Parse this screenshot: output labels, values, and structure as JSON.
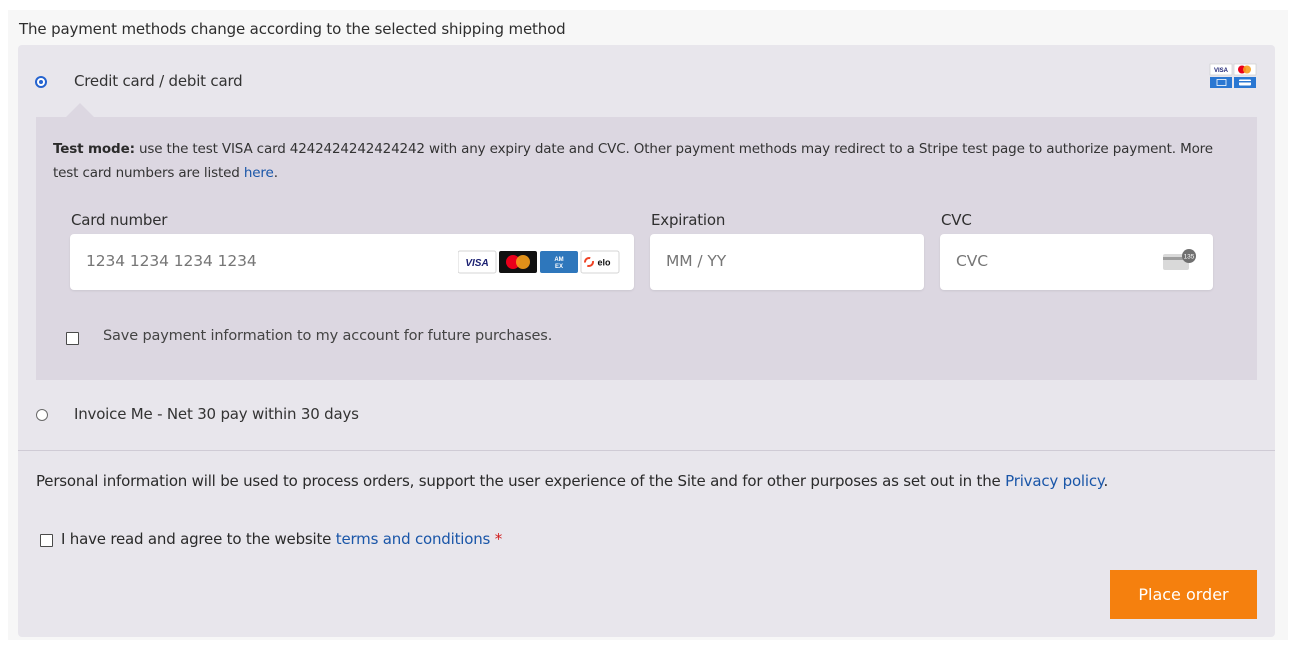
{
  "notice": "The payment methods change according to the selected shipping method",
  "payment_methods": [
    {
      "label": "Credit card / debit card",
      "selected": true
    },
    {
      "label": "Invoice Me - Net 30 pay within 30 days",
      "selected": false
    }
  ],
  "card_logos_icon": "credit-card-brands-icon",
  "test_mode": {
    "bold": "Test mode:",
    "text": " use the test VISA card 4242424242424242 with any expiry date and CVC. Other payment methods may redirect to a Stripe test page to authorize payment. More test card numbers are listed ",
    "link": "here",
    "end": "."
  },
  "fields": {
    "card_number": {
      "label": "Card number",
      "placeholder": "1234 1234 1234 1234",
      "brands": [
        "VISA",
        "mastercard",
        "AMEX",
        "elo"
      ]
    },
    "expiration": {
      "label": "Expiration",
      "placeholder": "MM / YY"
    },
    "cvc": {
      "label": "CVC",
      "placeholder": "CVC",
      "icon_text": "135"
    }
  },
  "save_payment": {
    "label": "Save payment information to my account for future purchases.",
    "checked": false
  },
  "privacy": {
    "text": "Personal information will be used to process orders, support the user experience of the Site and for other purposes as set out in the ",
    "link": "Privacy policy",
    "end": "."
  },
  "terms": {
    "prefix": "I have read and agree to the website ",
    "link": "terms and conditions",
    "required": "*",
    "checked": false
  },
  "place_order": "Place order",
  "colors": {
    "accent": "#2563cf",
    "link": "#1a56a8",
    "button": "#f5800e",
    "panel": "#e8e6ec",
    "box": "#dcd7e1"
  }
}
